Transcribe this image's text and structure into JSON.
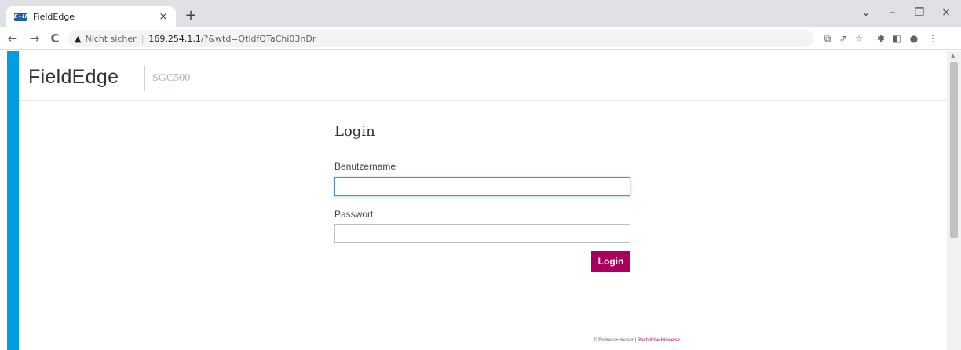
{
  "browser": {
    "tab": {
      "favicon_text": "E+H",
      "title": "FieldEdge",
      "close": "×"
    },
    "new_tab": "+",
    "window_controls": {
      "dropdown": "⌄",
      "minimize": "–",
      "restore": "❐",
      "close": "×"
    },
    "nav": {
      "back": "←",
      "forward": "→",
      "reload": "C"
    },
    "address": {
      "warning_icon": "▲",
      "not_secure": "Nicht sicher",
      "separator": "|",
      "host": "169.254.1.1",
      "path": "/?&wtd=OtldfQTaChi03nDr"
    },
    "toolbar_icons": {
      "translate": "⧉",
      "share": "⇗",
      "bookmark": "☆",
      "extensions": "✱",
      "side_panel": "◧",
      "profile": "●",
      "menu": "⋮"
    }
  },
  "app": {
    "brand": "FieldEdge",
    "device": "SGC500",
    "accent_color": "#009ee0",
    "button_color": "#a8005c"
  },
  "login": {
    "title": "Login",
    "username_label": "Benutzername",
    "username_value": "",
    "password_label": "Passwort",
    "password_value": "",
    "submit": "Login"
  },
  "footer": {
    "copyright": "© Endress+Hauser",
    "separator": "|",
    "legal_link": "Rechtliche Hinweise"
  }
}
